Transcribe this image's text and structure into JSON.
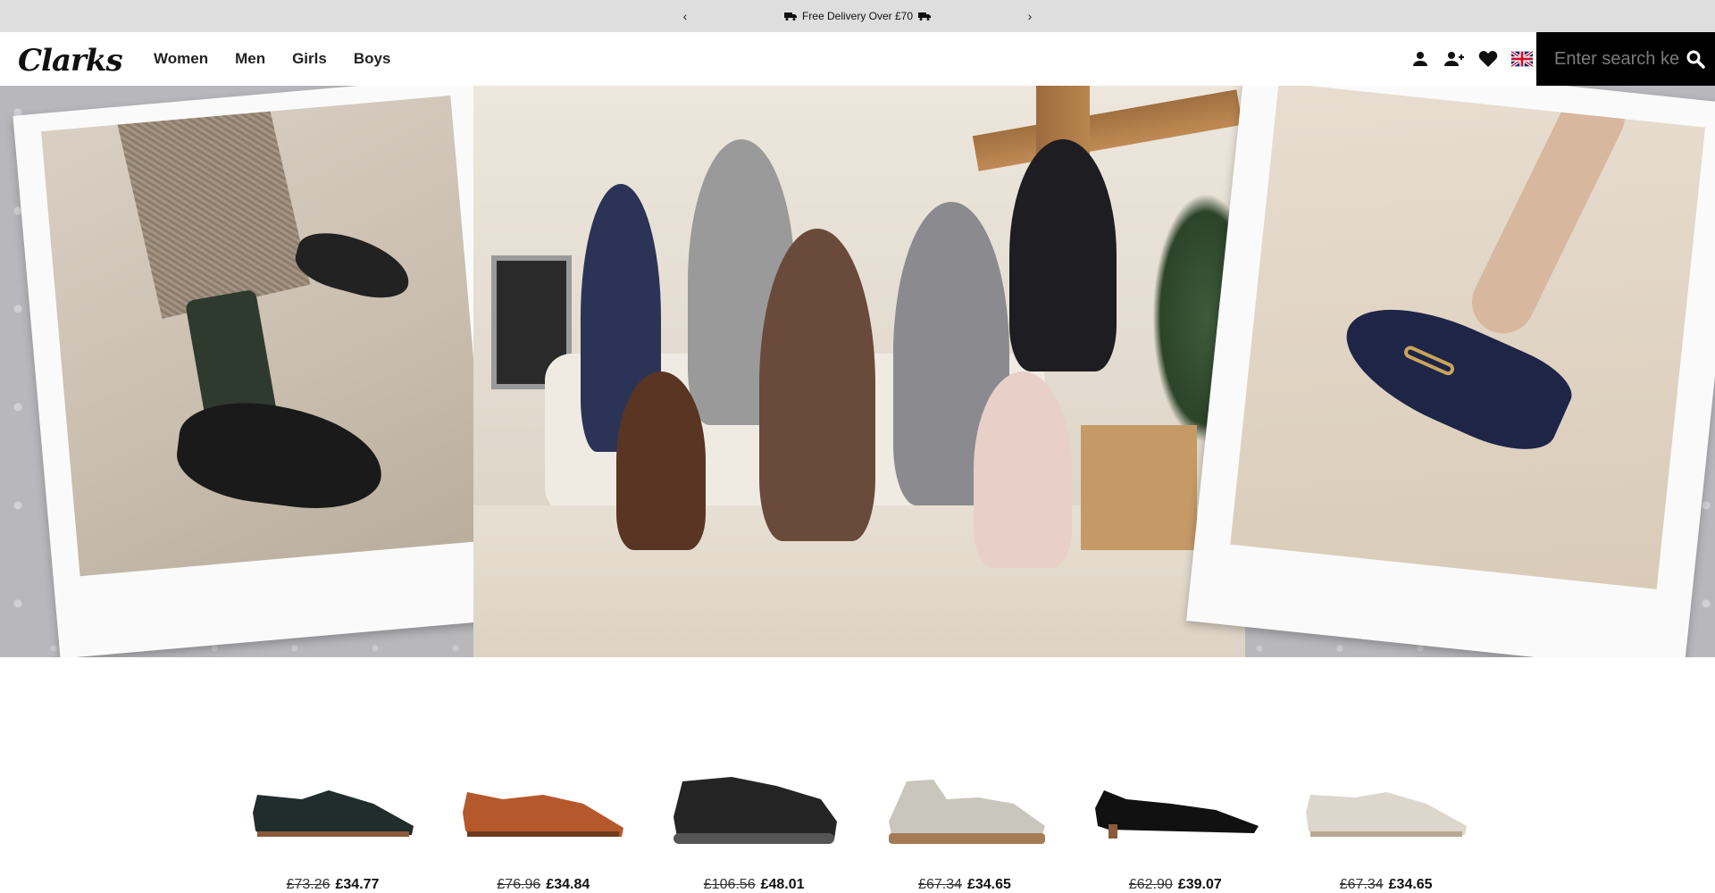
{
  "promo": {
    "message": "Free Delivery Over £70",
    "prev_icon": "chevron-left-icon",
    "next_icon": "chevron-right-icon",
    "prev_label": "‹",
    "next_label": "›"
  },
  "header": {
    "logo_text": "Clarks",
    "nav": [
      "Women",
      "Men",
      "Girls",
      "Boys"
    ],
    "icons": [
      "account-icon",
      "register-icon",
      "wishlist-heart-icon",
      "uk-flag-icon"
    ],
    "search": {
      "placeholder": "Enter search keyword",
      "icon": "search-icon"
    }
  },
  "hero": {
    "images": [
      "brogue-shoe-polaroid",
      "family-sofa-photo",
      "navy-pump-polaroid"
    ]
  },
  "products": [
    {
      "image": "black-slip-on-loafer",
      "was": "£73.26",
      "now": "£34.77"
    },
    {
      "image": "tan-slip-on-loafer",
      "was": "£76.96",
      "now": "£34.84"
    },
    {
      "image": "black-waterproof-trainer",
      "was": "£106.56",
      "now": "£48.01"
    },
    {
      "image": "cream-cork-sandal",
      "was": "£67.34",
      "now": "£34.65"
    },
    {
      "image": "black-slingback-flat",
      "was": "£62.90",
      "now": "£39.07"
    },
    {
      "image": "cream-loafer",
      "was": "£67.34",
      "now": "£34.65"
    }
  ],
  "colors": {
    "promo_bg": "#dedede",
    "search_bg": "#000000",
    "text": "#111111"
  }
}
